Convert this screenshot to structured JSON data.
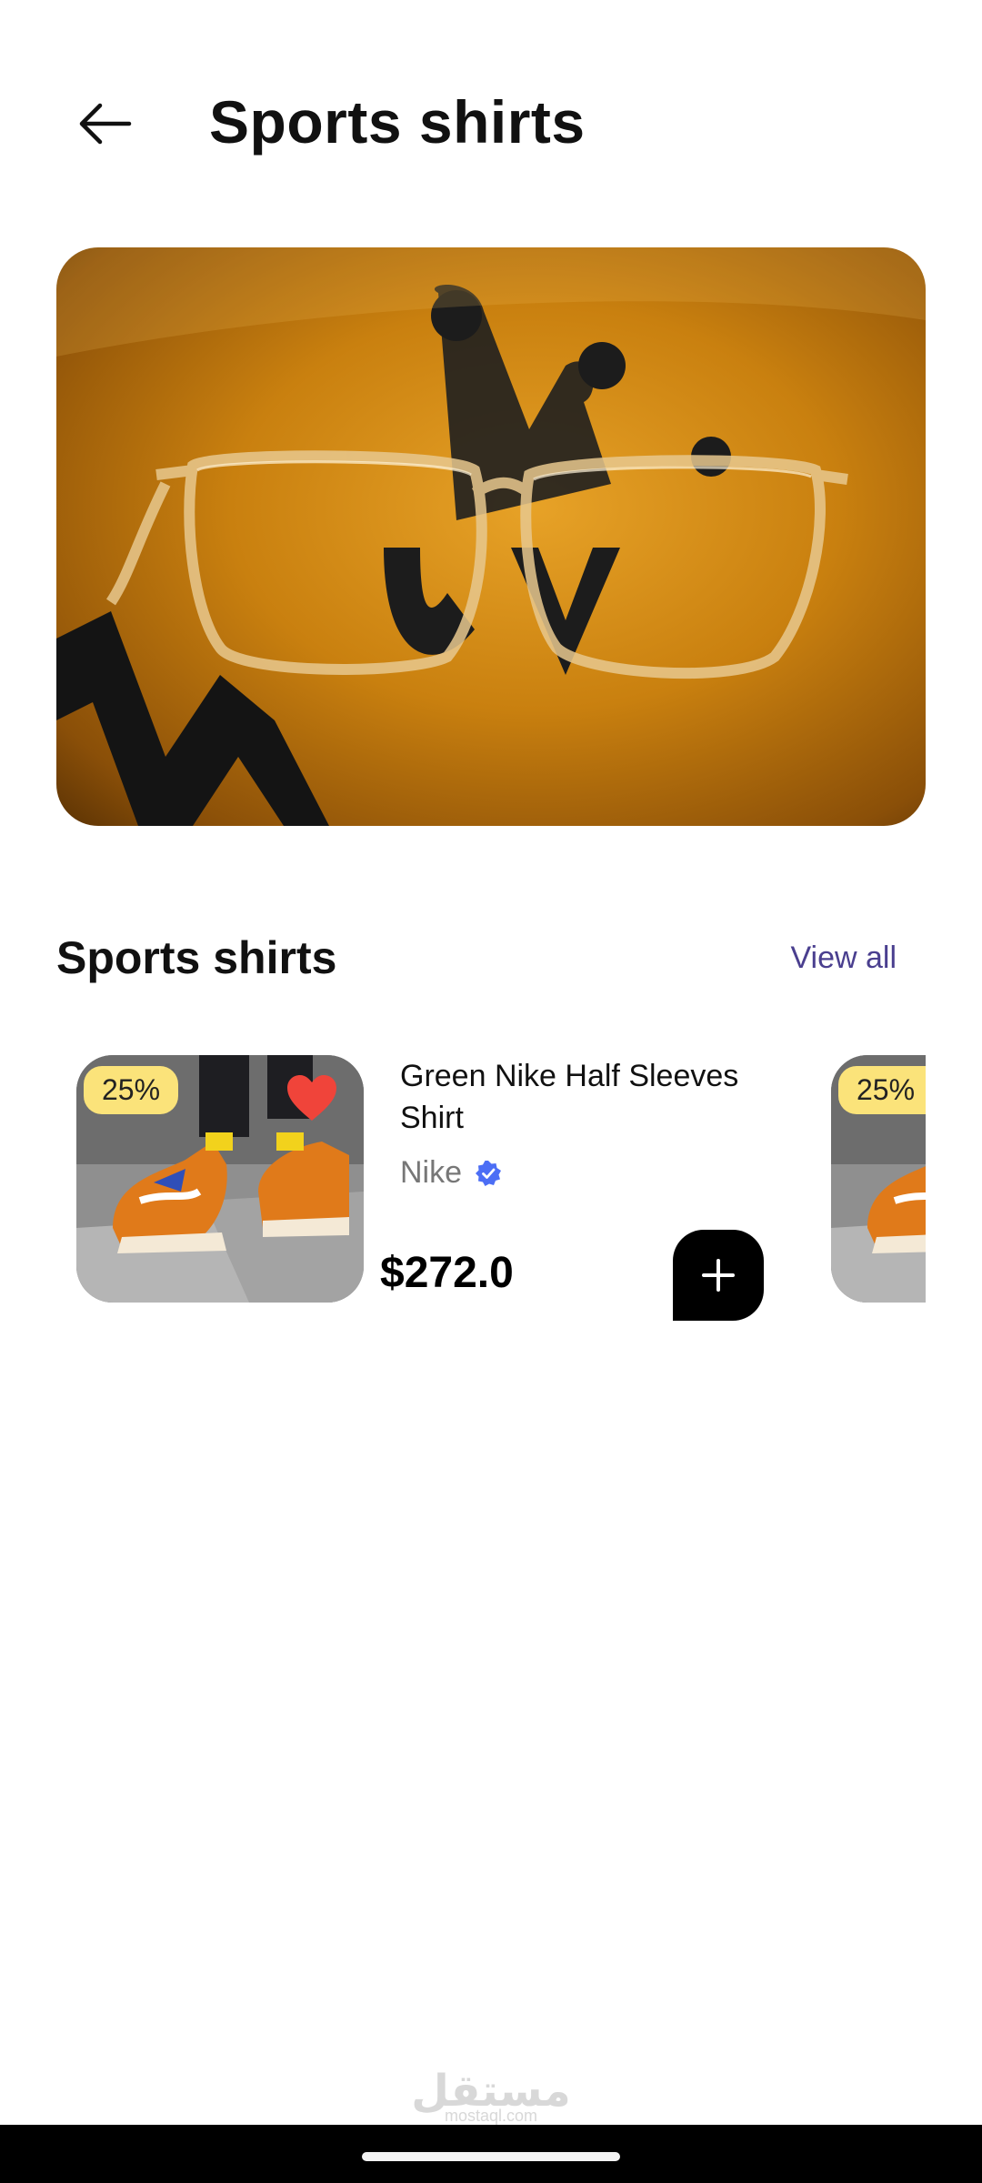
{
  "header": {
    "title": "Sports shirts",
    "back_icon": "arrow-left-icon"
  },
  "banner": {
    "image": "eyeglasses-on-yellow-bag-photo"
  },
  "section": {
    "title": "Sports shirts",
    "view_all_label": "View all"
  },
  "products": [
    {
      "discount": "25%",
      "name": "Green Nike Half Sleeves Shirt",
      "brand": "Nike",
      "price": "$272.0",
      "favorite": true,
      "image": "orange-sneakers-photo"
    },
    {
      "discount": "25%",
      "image": "orange-sneakers-photo"
    }
  ],
  "watermark": {
    "arabic": "مستقل",
    "latin": "mostaql.com"
  },
  "colors": {
    "accent": "#4a3f8f",
    "badge": "#fbe37a",
    "heart": "#f0443a",
    "verified": "#4c6ef5",
    "add_button": "#000000"
  }
}
